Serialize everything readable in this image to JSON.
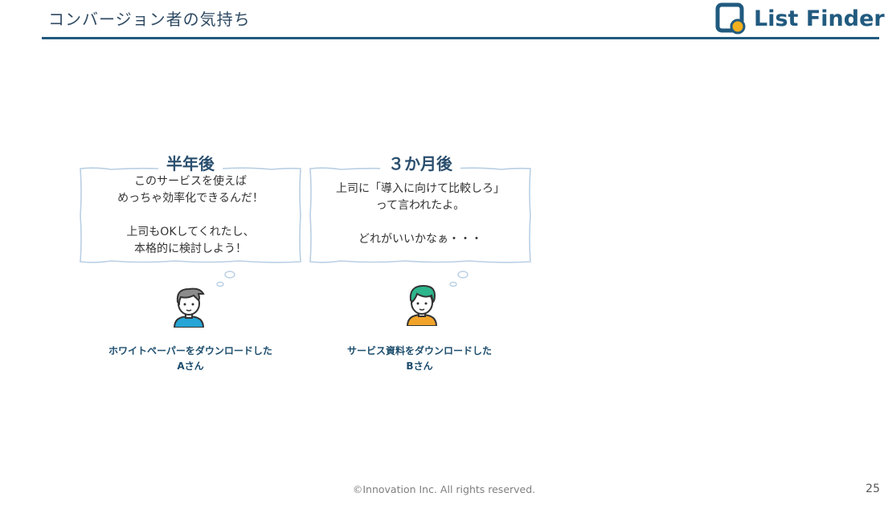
{
  "header": {
    "title": "コンバージョン者の気持ち",
    "brand": "List Finder"
  },
  "bubbles": [
    {
      "heading": "半年後",
      "lines": [
        "このサービスを使えば",
        "めっちゃ効率化できるんだ！",
        "",
        "上司もOKしてくれたし、",
        "本格的に検討しよう！"
      ]
    },
    {
      "heading": "３か月後",
      "lines": [
        "上司に「導入に向けて比較しろ」",
        "って言われたよ。",
        "",
        "どれがいいかなぁ・・・"
      ]
    }
  ],
  "personas": [
    {
      "caption_line1": "ホワイトペーパーをダウンロードした",
      "caption_line2": "Aさん",
      "hair_color": "#8c8c8c",
      "shirt_color": "#26a5d6"
    },
    {
      "caption_line1": "サービス資料をダウンロードした",
      "caption_line2": "Bさん",
      "hair_color": "#2db58c",
      "shirt_color": "#f2a42a"
    }
  ],
  "colors": {
    "accent": "#215a7f",
    "bubble_border": "#b9cfe3"
  },
  "footer": {
    "copyright": "©Innovation Inc. All rights reserved.",
    "page_number": "25"
  }
}
